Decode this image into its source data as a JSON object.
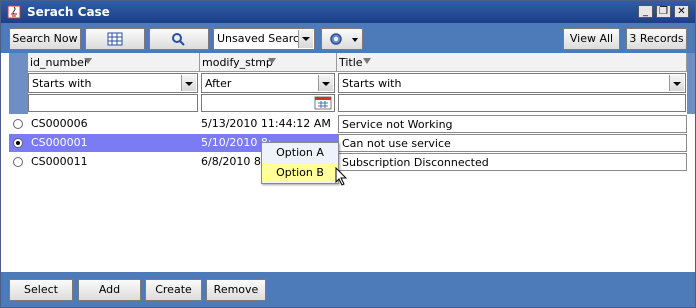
{
  "window": {
    "title": "Serach Case",
    "controls": [
      "minimize",
      "restore",
      "close"
    ]
  },
  "toolbar": {
    "search_now_label": "Search Now",
    "columns_icon": "grid-columns-icon",
    "search_icon": "magnifier-icon",
    "saved_search_value": "Unsaved Search",
    "settings_icon": "gear-icon",
    "view_all_label": "View All",
    "records_label": "3 Records"
  },
  "columns": [
    {
      "label": "id_number",
      "filter_op": "Starts with",
      "filter_value": ""
    },
    {
      "label": "modify_stmp",
      "filter_op": "After",
      "filter_value": ""
    },
    {
      "label": "Title",
      "filter_op": "Starts with",
      "filter_value": ""
    }
  ],
  "rows": [
    {
      "selected": false,
      "id": "CS000006",
      "modified": "5/13/2010 11:44:12 AM",
      "title": "Service not Working"
    },
    {
      "selected": true,
      "id": "CS000001",
      "modified": "5/10/2010 8:",
      "title": "Can not use service"
    },
    {
      "selected": false,
      "id": "CS000011",
      "modified": "6/8/2010 8:0",
      "title": "Subscription Disconnected"
    }
  ],
  "context_menu": {
    "options": [
      "Option A",
      "Option B"
    ],
    "highlighted": "Option B"
  },
  "bottom": {
    "select_label": "Select",
    "add_label": "Add",
    "create_label": "Create",
    "remove_label": "Remove"
  },
  "colors": {
    "title_bar": "#1c3f86",
    "toolbar": "#4d7ab8",
    "selected_row": "#7b7bf3",
    "menu_highlight": "#ffff99"
  }
}
